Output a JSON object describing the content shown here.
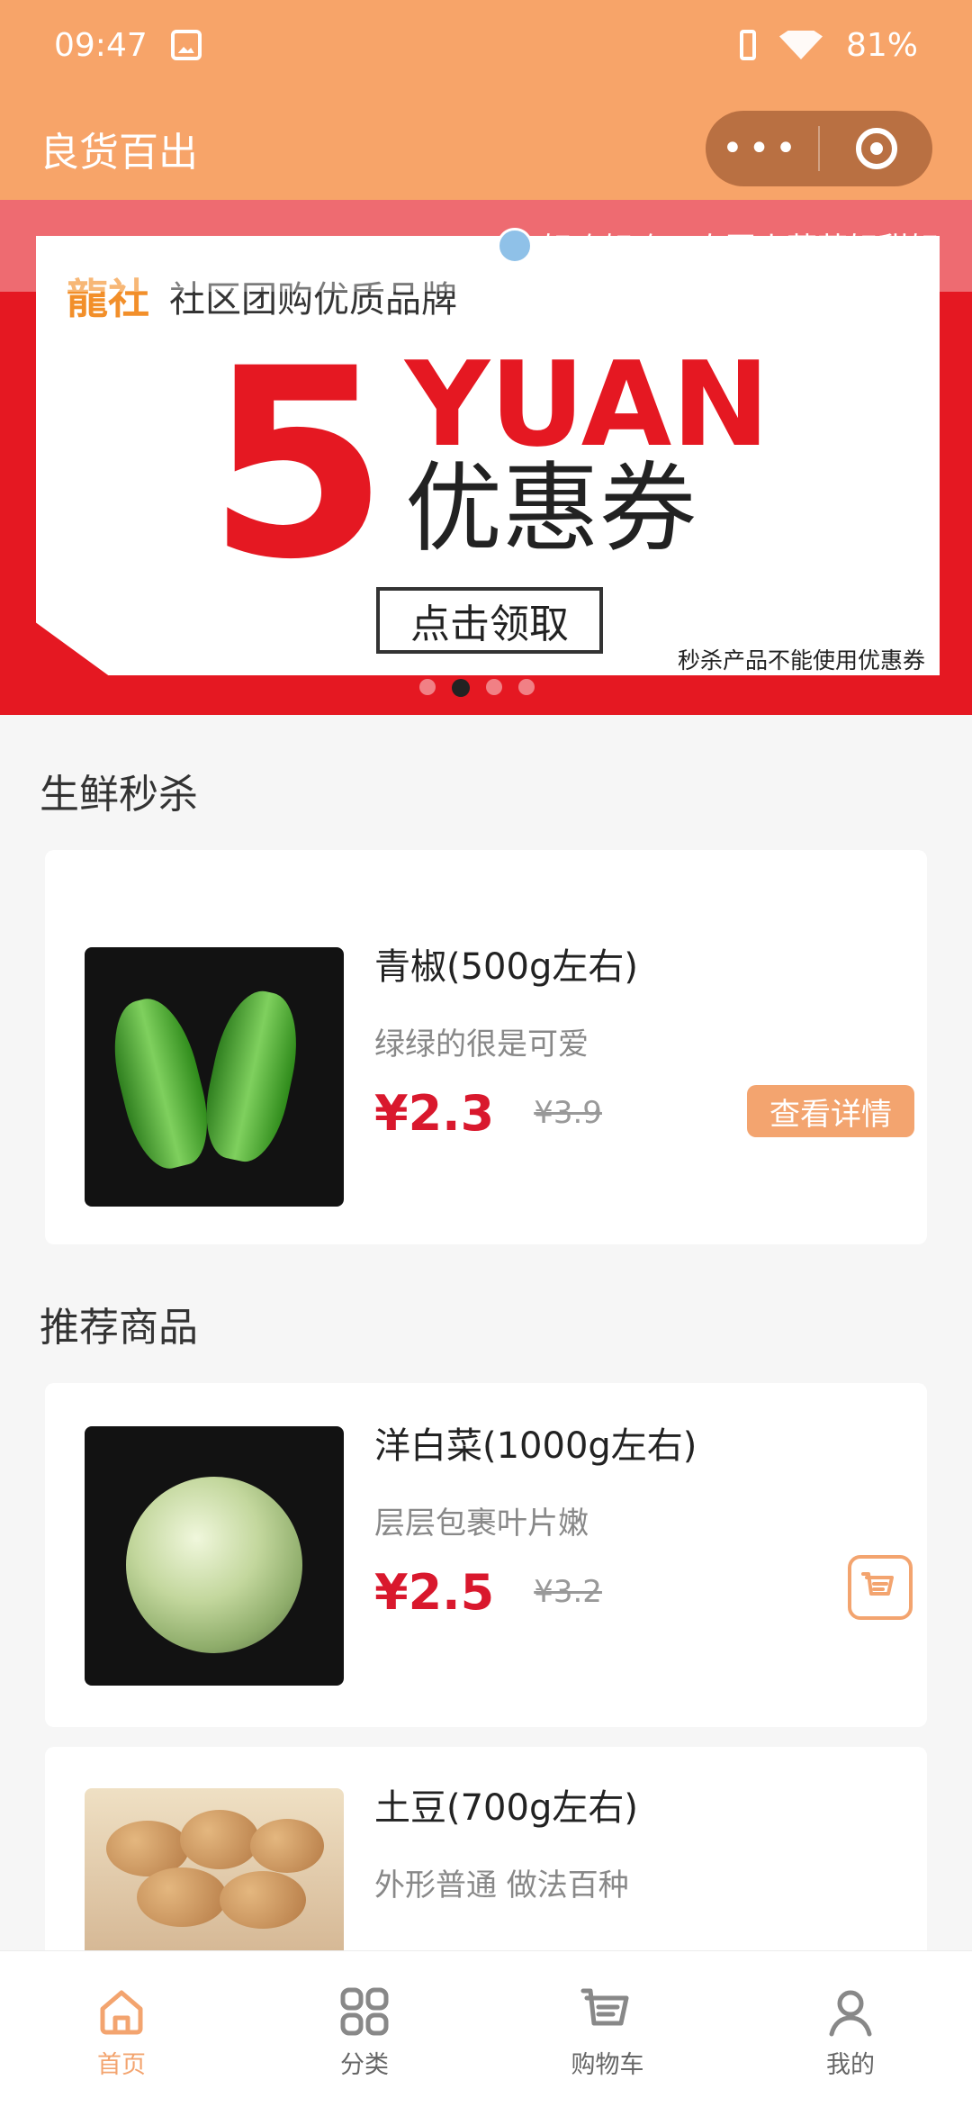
{
  "status": {
    "time": "09:47",
    "battery": "81%",
    "icons": [
      "image-icon",
      "vibrate-icon",
      "wifi-icon"
    ]
  },
  "header": {
    "title": "良货百出",
    "more_label": "•••"
  },
  "banner": {
    "brand_logo": "龍社",
    "brand_text": "社区团购优质品牌",
    "big_number": "5",
    "yuan_text": "YUAN",
    "coupon_text": "优惠券",
    "claim_label": "点击领取",
    "note": "秒杀产品不能使用优惠券",
    "notice": "好吃好吃～泰国小菠萝好甜好",
    "dots": [
      false,
      true,
      false,
      false
    ]
  },
  "sections": {
    "flash_title": "生鲜秒杀",
    "recommend_title": "推荐商品"
  },
  "products": {
    "flash_item": {
      "name": "青椒(500g左右)",
      "desc": "绿绿的很是可爱",
      "price": "¥2.3",
      "old_price": "¥3.9",
      "detail_label": "查看详情"
    },
    "recommend": [
      {
        "name": "洋白菜(1000g左右)",
        "desc": "层层包裹叶片嫩",
        "price": "¥2.5",
        "old_price": "¥3.2"
      },
      {
        "name": "土豆(700g左右)",
        "desc": "外形普通 做法百种"
      }
    ]
  },
  "tabs": [
    {
      "label": "首页",
      "icon": "home-icon",
      "active": true
    },
    {
      "label": "分类",
      "icon": "category-icon",
      "active": false
    },
    {
      "label": "购物车",
      "icon": "cart-icon",
      "active": false
    },
    {
      "label": "我的",
      "icon": "profile-icon",
      "active": false
    }
  ],
  "colors": {
    "primary": "#f7a469",
    "accent": "#f3a46f",
    "price": "#d9182d",
    "banner_red": "#e51822"
  }
}
